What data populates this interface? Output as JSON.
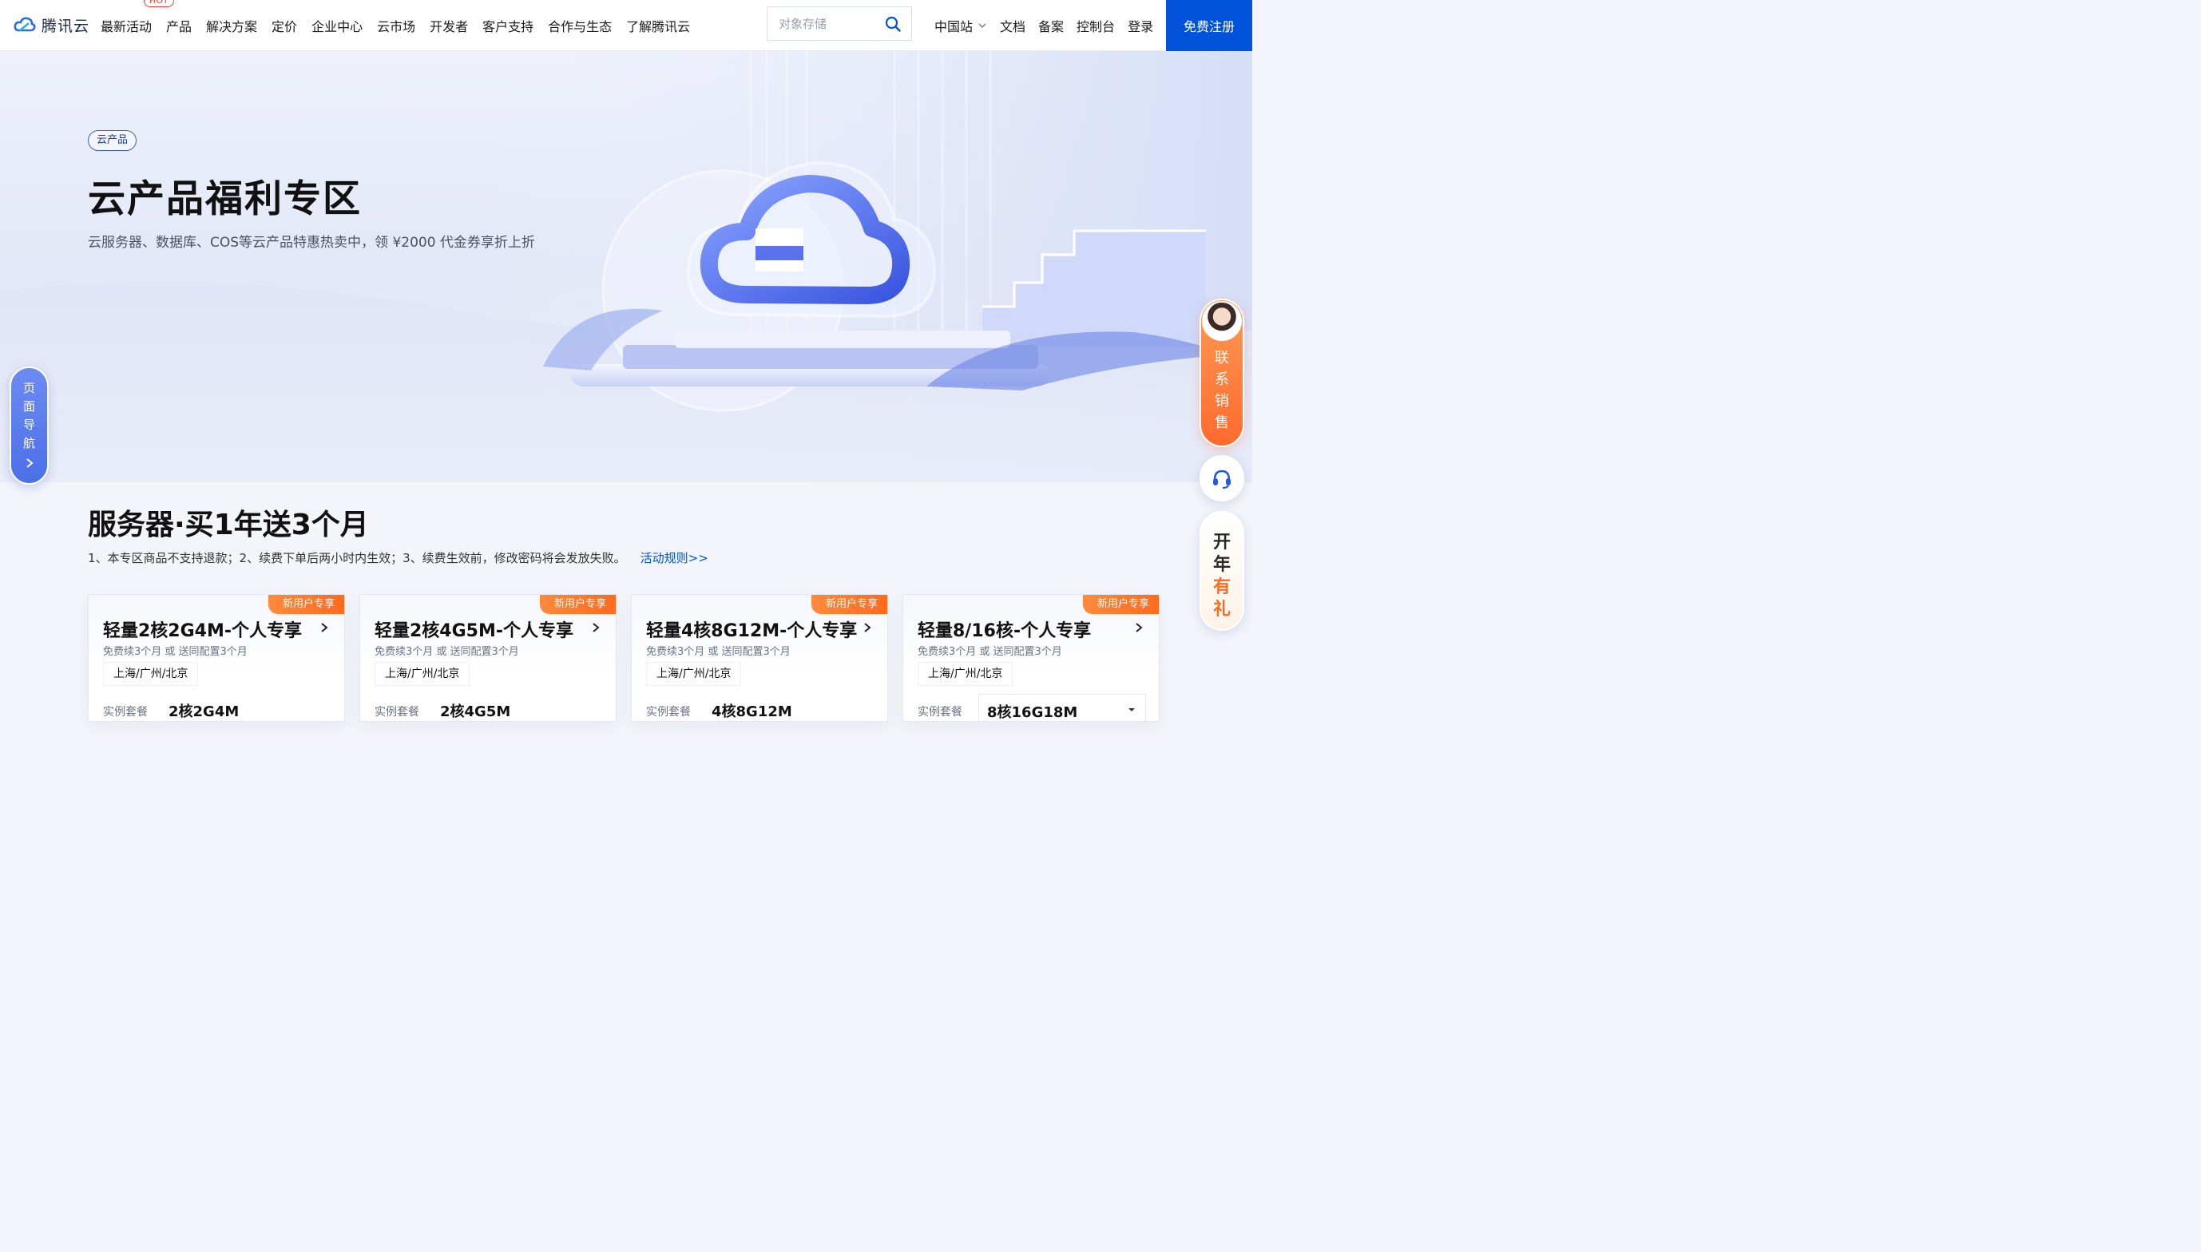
{
  "header": {
    "logo_text": "腾讯云",
    "hot_badge": "HOT",
    "nav": [
      "最新活动",
      "产品",
      "解决方案",
      "定价",
      "企业中心",
      "云市场",
      "开发者",
      "客户支持",
      "合作与生态",
      "了解腾讯云"
    ],
    "search_placeholder": "对象存储",
    "right_nav": {
      "region": "中国站",
      "docs": "文档",
      "record": "备案",
      "console": "控制台",
      "login": "登录"
    },
    "register": "免费注册"
  },
  "hero": {
    "tag": "云产品",
    "title": "云产品福利专区",
    "subtitle": "云服务器、数据库、COS等云产品特惠热卖中，领 ¥2000 代金券享折上折"
  },
  "page_nav": {
    "label": "页面导航"
  },
  "floating": {
    "sales": "联系销售",
    "gift_top": "开年",
    "gift_bottom": "有礼"
  },
  "section": {
    "title": "服务器·买1年送3个月",
    "notice": "1、本专区商品不支持退款；2、续费下单后两小时内生效；3、续费生效前，修改密码将会发放失败。",
    "rules_link": "活动规则>>"
  },
  "cards": [
    {
      "badge": "新用户专享",
      "title": "轻量2核2G4M-个人专享",
      "desc": "免费续3个月 或 送同配置3个月",
      "region": "上海/广州/北京",
      "spec_label": "实例套餐",
      "spec_value": "2核2G4M"
    },
    {
      "badge": "新用户专享",
      "title": "轻量2核4G5M-个人专享",
      "desc": "免费续3个月 或 送同配置3个月",
      "region": "上海/广州/北京",
      "spec_label": "实例套餐",
      "spec_value": "2核4G5M"
    },
    {
      "badge": "新用户专享",
      "title": "轻量4核8G12M-个人专享",
      "desc": "免费续3个月 或 送同配置3个月",
      "region": "上海/广州/北京",
      "spec_label": "实例套餐",
      "spec_value": "4核8G12M"
    },
    {
      "badge": "新用户专享",
      "title": "轻量8/16核-个人专享",
      "desc": "免费续3个月 或 送同配置3个月",
      "region": "上海/广州/北京",
      "spec_label": "实例套餐",
      "spec_value": "8核16G18M"
    }
  ],
  "colors": {
    "brand_blue": "#0052d9",
    "badge_orange": "#ff6a1e",
    "hot_red": "#ff3b30"
  }
}
